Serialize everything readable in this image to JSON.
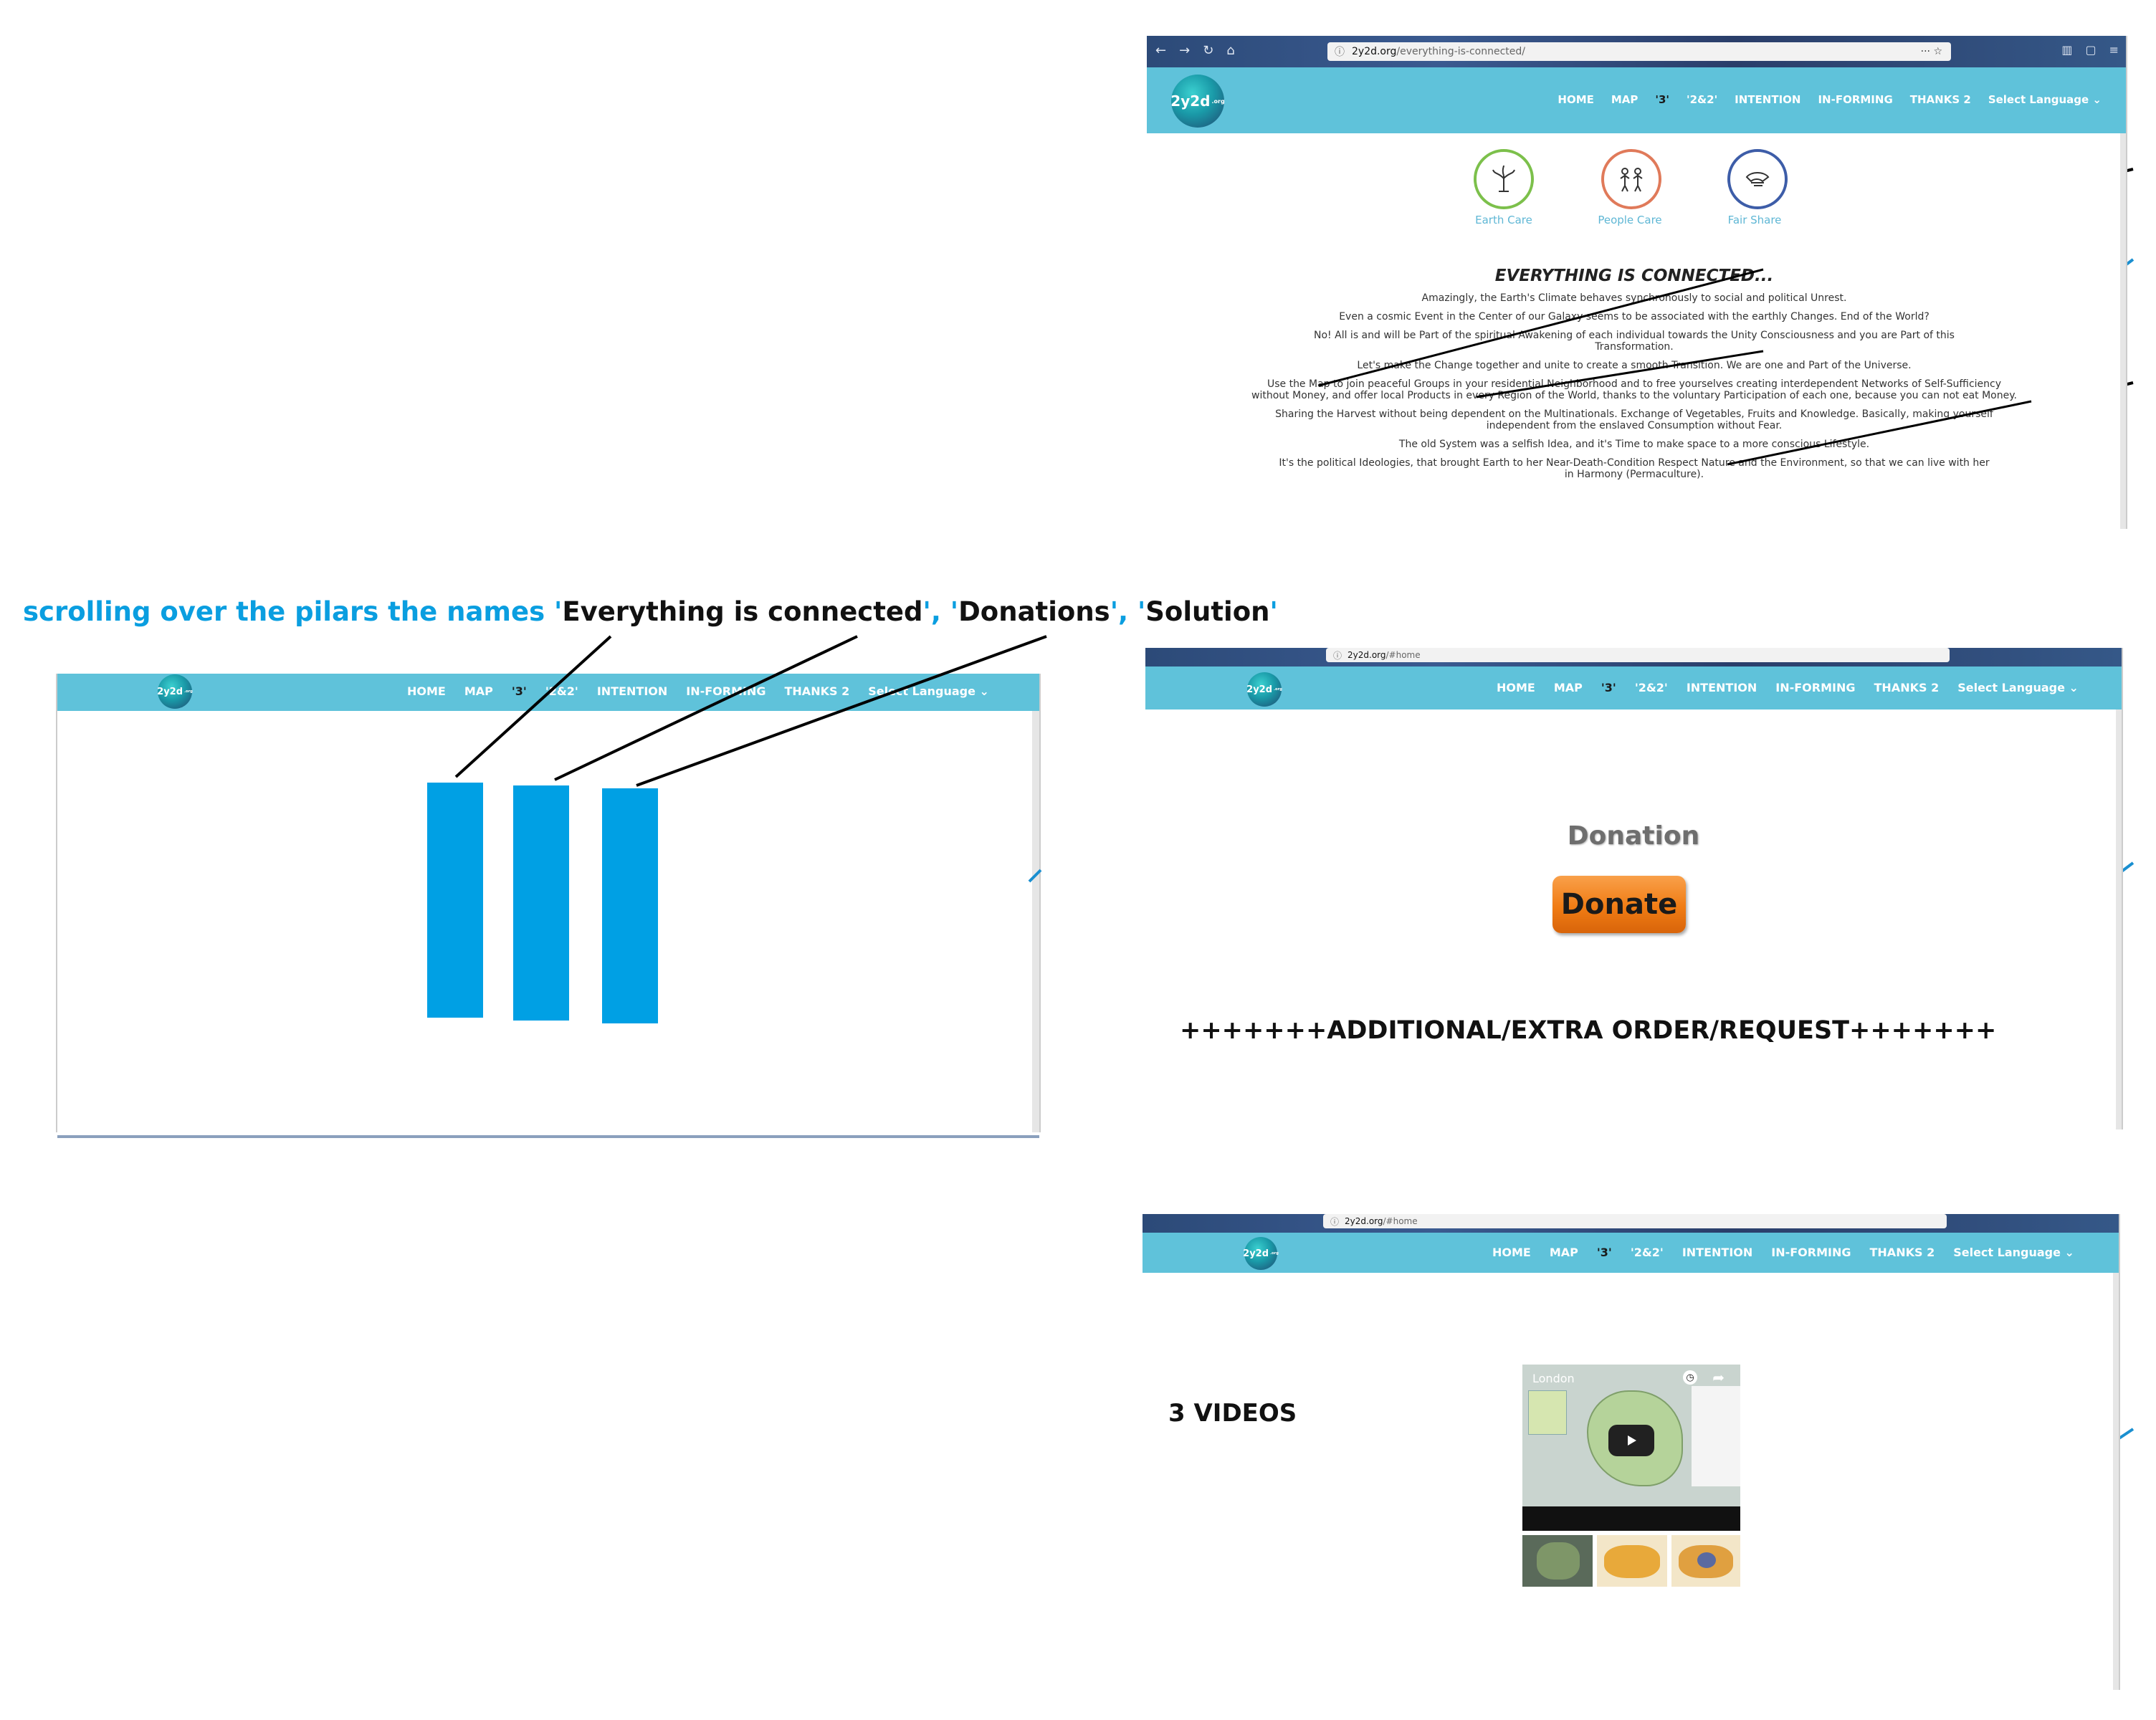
{
  "colors": {
    "nav_bg": "#5fc2da",
    "accent_blue": "#009fe3",
    "pillar_blue": "#00a0e4",
    "donate_orange": "#f07c14",
    "earth_green": "#7cc04b",
    "people_orange": "#e07a5a",
    "share_blue": "#3d5da8"
  },
  "nav": {
    "items": [
      "HOME",
      "MAP",
      "'3'",
      "'2&2'",
      "INTENTION",
      "IN-FORMING",
      "THANKS 2",
      "Select Language ⌄"
    ],
    "logo_text": "2y2d",
    "logo_sup": ".org"
  },
  "annotation": {
    "part1": "scrolling over the pilars the names ",
    "q1": "'",
    "name1": "Everything is connected",
    "sep1": "', '",
    "name2": "Donations",
    "sep2": "', '",
    "name3": "Solution",
    "q_end": "'"
  },
  "panel_top": {
    "url_host": "2y2d.org",
    "url_path": "/everything-is-connected/",
    "pillars": [
      {
        "label": "Earth Care",
        "icon": "earth-care-icon"
      },
      {
        "label": "People Care",
        "icon": "people-care-icon"
      },
      {
        "label": "Fair Share",
        "icon": "fair-share-icon"
      }
    ],
    "heading": "EVERYTHING IS CONNECTED...",
    "paragraphs": [
      "Amazingly, the Earth's Climate behaves synchronously to social and political Unrest.",
      "Even a cosmic Event in the Center of our Galaxy seems to be associated with the earthly Changes. End of the World?",
      "No! All is and will be Part of the spiritual Awakening of each individual towards the Unity Consciousness and you are Part of this Transformation.",
      "Let's make the Change together and unite to create a smooth Transition. We are one and Part of the Universe.",
      "Use the Map to join peaceful Groups in your residential Neighborhood and to free yourselves creating interdependent Networks of Self-Sufficiency without Money, and offer local Products in every Region of the World, thanks to the voluntary Participation of each one, because you can not eat Money.",
      "Sharing the Harvest without being dependent on the Multinationals. Exchange of Vegetables, Fruits and Knowledge. Basically, making yourself independent from the enslaved Consumption without Fear.",
      "The old System was a selfish Idea, and it's Time to make space to a more conscious Lifestyle.",
      "It's the political Ideologies, that brought Earth to her Near-Death-Condition Respect Nature and the Environment, so that we can live with her in Harmony (Permaculture)."
    ]
  },
  "panel_mid": {
    "url_host": "2y2d.org",
    "url_path": "/#home",
    "donation_title": "Donation",
    "donate_button": "Donate",
    "extra_order": "+++++++ADDITIONAL/EXTRA ORDER/REQUEST+++++++"
  },
  "panel_bottom": {
    "url_host": "2y2d.org",
    "url_path": "/#home",
    "video_title": "London",
    "videos_label": "3 VIDEOS"
  }
}
